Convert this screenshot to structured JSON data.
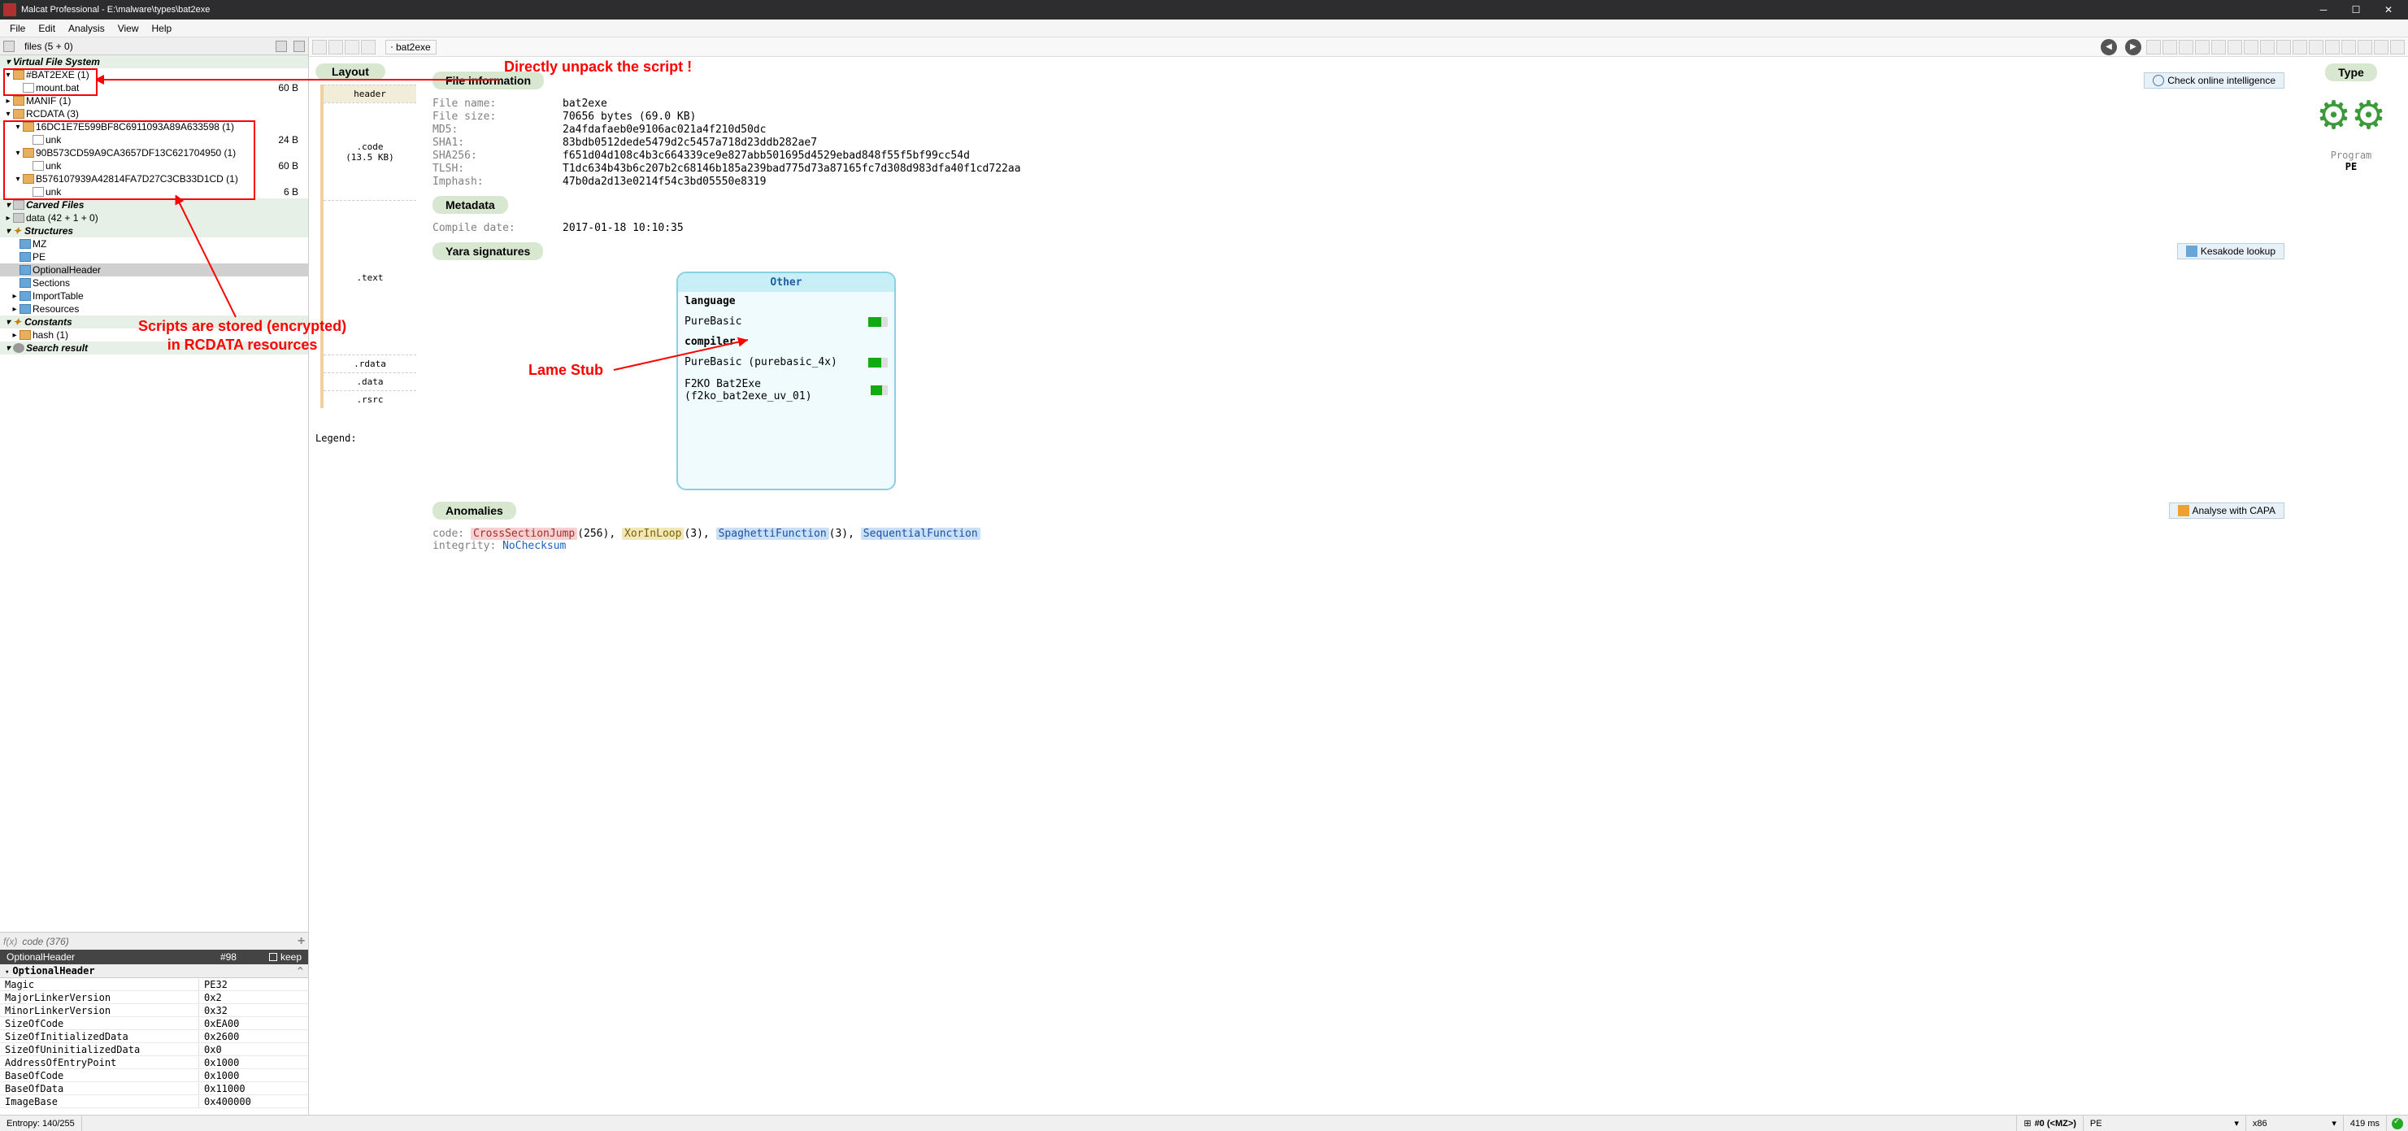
{
  "window": {
    "title": "Malcat Professional - E:\\malware\\types\\bat2exe"
  },
  "menu": [
    "File",
    "Edit",
    "Analysis",
    "View",
    "Help"
  ],
  "left_tab": "files (5 + 0)",
  "tree": {
    "vfs_header": "Virtual File System",
    "bat2exe": {
      "label": "#BAT2EXE (1)"
    },
    "mount": {
      "label": "mount.bat",
      "size": "60 B"
    },
    "manif": {
      "label": "MANIF (1)"
    },
    "rcdata": {
      "label": "RCDATA (3)"
    },
    "r1": {
      "label": "16DC1E7E599BF8C6911093A89A633598 (1)"
    },
    "r1u": {
      "label": "unk",
      "size": "24 B"
    },
    "r2": {
      "label": "90B573CD59A9CA3657DF13C621704950 (1)"
    },
    "r2u": {
      "label": "unk",
      "size": "60 B"
    },
    "r3": {
      "label": "B576107939A42814FA7D27C3CB33D1CD (1)"
    },
    "r3u": {
      "label": "unk",
      "size": "6 B"
    },
    "carved_header": "Carved Files",
    "data": {
      "label": "data (42 + 1 + 0)"
    },
    "struct_header": "Structures",
    "structs": [
      "MZ",
      "PE",
      "OptionalHeader",
      "Sections",
      "ImportTable",
      "Resources"
    ],
    "const_header": "Constants",
    "hash": {
      "label": "hash (1)"
    },
    "search_header": "Search result"
  },
  "filter": {
    "label": "f(x)",
    "text": "code (376)"
  },
  "prop": {
    "title": "OptionalHeader",
    "num": "#98",
    "keep": "keep",
    "name": "OptionalHeader",
    "rows": [
      {
        "k": "Magic",
        "v": "PE32"
      },
      {
        "k": "MajorLinkerVersion",
        "v": "0x2"
      },
      {
        "k": "MinorLinkerVersion",
        "v": "0x32"
      },
      {
        "k": "SizeOfCode",
        "v": "0xEA00"
      },
      {
        "k": "SizeOfInitializedData",
        "v": "0x2600"
      },
      {
        "k": "SizeOfUninitializedData",
        "v": "0x0"
      },
      {
        "k": "AddressOfEntryPoint",
        "v": "0x1000"
      },
      {
        "k": "BaseOfCode",
        "v": "0x1000"
      },
      {
        "k": "BaseOfData",
        "v": "0x11000"
      },
      {
        "k": "ImageBase",
        "v": "0x400000"
      }
    ]
  },
  "crumb": "bat2exe",
  "layout": {
    "title": "Layout",
    "header": "header",
    "code": ".code",
    "codesize": "(13.5 KB)",
    "text": ".text",
    "rdata": ".rdata",
    "dat": ".data",
    "rsrc": ".rsrc",
    "legend": "Legend:"
  },
  "info": {
    "fileinfo_title": "File information",
    "online_btn": "Check online intelligence",
    "type_title": "Type",
    "type_program": "Program",
    "type_pe": "PE",
    "fn_k": "File name:",
    "fn_v": "bat2exe",
    "fs_k": "File size:",
    "fs_v": "70656 bytes (69.0 KB)",
    "md5_k": "MD5:",
    "md5_v": "2a4fdafaeb0e9106ac021a4f210d50dc",
    "sha1_k": "SHA1:",
    "sha1_v": "83bdb0512dede5479d2c5457a718d23ddb282ae7",
    "sha256_k": "SHA256:",
    "sha256_v": "f651d04d108c4b3c664339ce9e827abb501695d4529ebad848f55f5bf99cc54d",
    "tlsh_k": "TLSH:",
    "tlsh_v": "T1dc634b43b6c207b2c68146b185a239bad775d73a87165fc7d308d983dfa40f1cd722aa",
    "imp_k": "Imphash:",
    "imp_v": "47b0da2d13e0214f54c3bd05550e8319",
    "meta_title": "Metadata",
    "cd_k": "Compile date:",
    "cd_v": "2017-01-18 10:10:35",
    "yara_title": "Yara signatures",
    "kesa_btn": "Kesakode lookup",
    "yara_other": "Other",
    "yara_lang": "language",
    "yara_pb": "PureBasic",
    "yara_comp": "compiler",
    "yara_pb4": "PureBasic (purebasic_4x)",
    "yara_b2e": "F2KO Bat2Exe (f2ko_bat2exe_uv_01)",
    "anom_title": "Anomalies",
    "capa_btn": "Analyse with CAPA",
    "anom_code_k": "code:",
    "anom_csj": "CrossSectionJump",
    "anom_csj_n": "(256), ",
    "anom_xil": "XorInLoop",
    "anom_xil_n": "(3), ",
    "anom_sf": "SpaghettiFunction",
    "anom_sf_n": "(3), ",
    "anom_sq": "SequentialFunction",
    "anom_int_k": "integrity:",
    "anom_int_v": "NoChecksum"
  },
  "status": {
    "entropy": "Entropy: 140/255",
    "bc": "#0 (<MZ>)",
    "pe": "PE",
    "arch": "x86",
    "time": "419 ms"
  },
  "annotations": {
    "a1": "Directly unpack the script !",
    "a2a": "Scripts are stored (encrypted)",
    "a2b": "in RCDATA resources",
    "a3": "Lame Stub"
  }
}
